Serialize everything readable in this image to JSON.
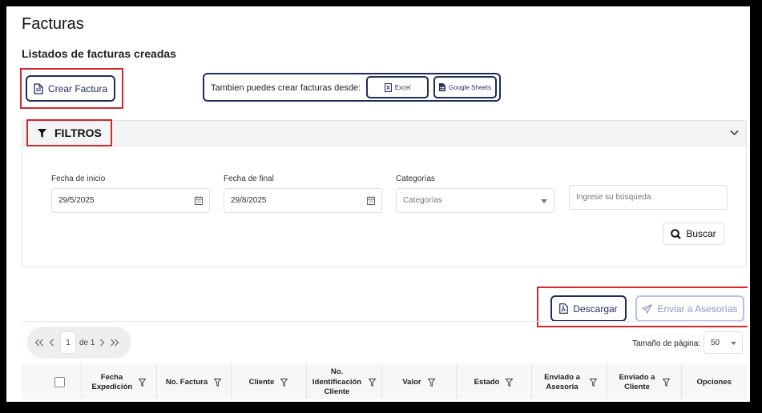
{
  "page": {
    "title": "Facturas",
    "subtitle": "Listados de facturas creadas"
  },
  "actions": {
    "create_invoice": "Crear Factura",
    "also_create_from": "Tambien puedes crear facturas desde:",
    "excel": "Excel",
    "google_sheets": "Google Sheets"
  },
  "filters": {
    "header": "FILTROS",
    "start_date_label": "Fecha de inicio",
    "start_date_value": "29/5/2025",
    "end_date_label": "Fecha de final",
    "end_date_value": "29/8/2025",
    "categories_label": "Categorías",
    "categories_placeholder": "Categorías",
    "search_placeholder": "Ingrese su búsqueda",
    "search_button": "Buscar"
  },
  "toolbar": {
    "download": "Descargar",
    "send_to_advisors": "Enviar a Asesorías"
  },
  "pagination": {
    "current_page": "1",
    "of_total": "de 1",
    "page_size_label": "Tamaño de página:",
    "page_size_value": "50"
  },
  "table": {
    "columns": [
      "Fecha Expedición",
      "No. Factura",
      "Cliente",
      "No. Identificación Cliente",
      "Valor",
      "Estado",
      "Enviado a Asesoría",
      "Enviado a Cliente",
      "Opciones"
    ]
  },
  "colors": {
    "navy": "#1f2d5c",
    "highlight_red": "#d9262a",
    "disabled_blue": "#8a96c8"
  }
}
